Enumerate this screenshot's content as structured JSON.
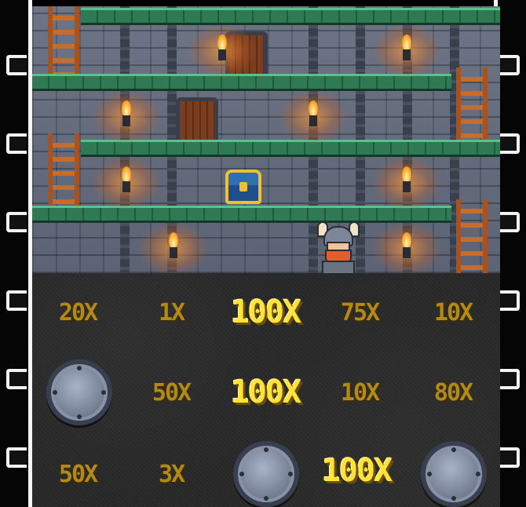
{
  "board": {
    "rows": [
      [
        "20X",
        "1X",
        "100X",
        "75X",
        "10X"
      ],
      [
        "",
        "50X",
        "100X",
        "10X",
        "80X"
      ],
      [
        "50X",
        "3X",
        "",
        "100X",
        ""
      ]
    ]
  },
  "colors": {
    "multiplier_dim": "#b48a16",
    "multiplier_highlight": "#ffe23a",
    "castle_stone": "#6c7486",
    "ledge_green": "#2f7a55",
    "ladder_wood": "#c66d2e"
  },
  "icons": [
    "torch-icon",
    "ladder-icon",
    "door-icon",
    "treasure-chest-icon",
    "viking-character-icon",
    "shield-icon"
  ]
}
